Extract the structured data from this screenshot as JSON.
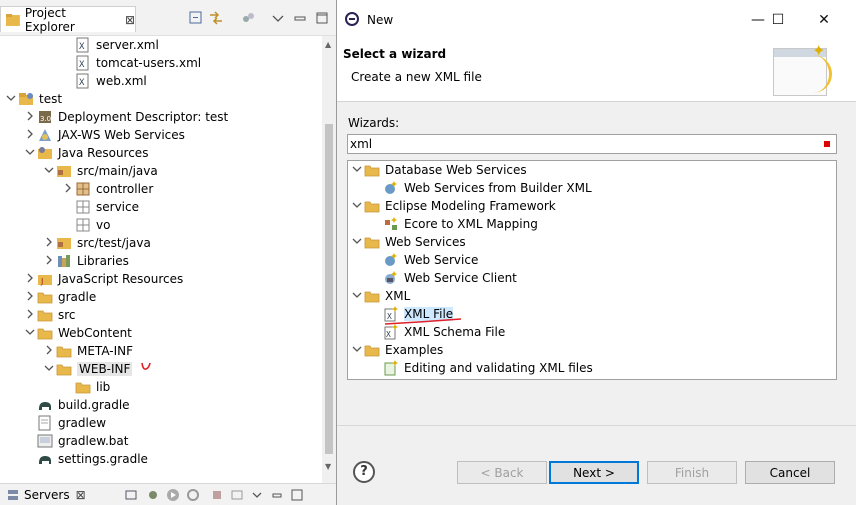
{
  "project_explorer": {
    "tab_label": "Project Explorer",
    "close_glyph": "⊠",
    "toolbar_icons": [
      "collapse-all-icon",
      "link-with-editor-icon",
      "filters-icon",
      "view-menu-icon",
      "minimize-icon",
      "maximize-icon"
    ],
    "tree": [
      {
        "label": "server.xml",
        "depth": 3,
        "icon": "xml-file-icon",
        "twisty": ""
      },
      {
        "label": "tomcat-users.xml",
        "depth": 3,
        "icon": "xml-file-icon",
        "twisty": ""
      },
      {
        "label": "web.xml",
        "depth": 3,
        "icon": "xml-file-icon",
        "twisty": ""
      },
      {
        "label": "test",
        "depth": 0,
        "icon": "project-icon",
        "twisty": "open"
      },
      {
        "label": "Deployment Descriptor: test",
        "depth": 1,
        "icon": "deployment-descriptor-icon",
        "twisty": "closed"
      },
      {
        "label": "JAX-WS Web Services",
        "depth": 1,
        "icon": "jaxws-icon",
        "twisty": "closed"
      },
      {
        "label": "Java Resources",
        "depth": 1,
        "icon": "java-resources-icon",
        "twisty": "open"
      },
      {
        "label": "src/main/java",
        "depth": 2,
        "icon": "source-folder-icon",
        "twisty": "open"
      },
      {
        "label": "controller",
        "depth": 3,
        "icon": "package-icon",
        "twisty": "closed"
      },
      {
        "label": "service",
        "depth": 3,
        "icon": "empty-package-icon",
        "twisty": ""
      },
      {
        "label": "vo",
        "depth": 3,
        "icon": "empty-package-icon",
        "twisty": ""
      },
      {
        "label": "src/test/java",
        "depth": 2,
        "icon": "source-folder-icon",
        "twisty": "closed"
      },
      {
        "label": "Libraries",
        "depth": 2,
        "icon": "libraries-icon",
        "twisty": "closed"
      },
      {
        "label": "JavaScript Resources",
        "depth": 1,
        "icon": "javascript-resources-icon",
        "twisty": "closed"
      },
      {
        "label": "gradle",
        "depth": 1,
        "icon": "folder-icon",
        "twisty": "closed"
      },
      {
        "label": "src",
        "depth": 1,
        "icon": "folder-icon",
        "twisty": "closed"
      },
      {
        "label": "WebContent",
        "depth": 1,
        "icon": "folder-icon",
        "twisty": "open"
      },
      {
        "label": "META-INF",
        "depth": 2,
        "icon": "folder-icon",
        "twisty": "closed"
      },
      {
        "label": "WEB-INF",
        "depth": 2,
        "icon": "folder-icon",
        "twisty": "open",
        "selected": true
      },
      {
        "label": "lib",
        "depth": 3,
        "icon": "folder-icon",
        "twisty": ""
      },
      {
        "label": "build.gradle",
        "depth": 1,
        "icon": "gradle-icon",
        "twisty": ""
      },
      {
        "label": "gradlew",
        "depth": 1,
        "icon": "file-icon",
        "twisty": ""
      },
      {
        "label": "gradlew.bat",
        "depth": 1,
        "icon": "bat-file-icon",
        "twisty": ""
      },
      {
        "label": "settings.gradle",
        "depth": 1,
        "icon": "gradle-icon",
        "twisty": ""
      }
    ]
  },
  "servers": {
    "tab_label": "Servers",
    "close_glyph": "⊠",
    "toolbar_icons": [
      "server-list-icon",
      "debug-server-icon",
      "start-server-icon",
      "profile-server-icon",
      "stop-server-icon",
      "publish-icon",
      "view-menu-icon",
      "minimize-icon",
      "maximize-icon"
    ]
  },
  "dialog": {
    "title": "New",
    "controls": {
      "minimize": "—",
      "maximize": "☐",
      "close": "✕"
    },
    "heading": "Select a wizard",
    "description": "Create a new XML file",
    "wizards_label": "Wizards:",
    "filter_value": "xml",
    "tree": [
      {
        "label": "Database Web Services",
        "depth": 0,
        "icon": "folder-icon",
        "twisty": "open"
      },
      {
        "label": "Web Services from Builder XML",
        "depth": 1,
        "icon": "web-service-wizard-icon",
        "twisty": ""
      },
      {
        "label": "Eclipse Modeling Framework",
        "depth": 0,
        "icon": "folder-icon",
        "twisty": "open"
      },
      {
        "label": "Ecore to XML Mapping",
        "depth": 1,
        "icon": "ecore-mapping-icon",
        "twisty": ""
      },
      {
        "label": "Web Services",
        "depth": 0,
        "icon": "folder-icon",
        "twisty": "open"
      },
      {
        "label": "Web Service",
        "depth": 1,
        "icon": "web-service-wizard-icon",
        "twisty": ""
      },
      {
        "label": "Web Service Client",
        "depth": 1,
        "icon": "web-service-client-icon",
        "twisty": ""
      },
      {
        "label": "XML",
        "depth": 0,
        "icon": "folder-icon",
        "twisty": "open"
      },
      {
        "label": "XML File",
        "depth": 1,
        "icon": "xml-file-wizard-icon",
        "twisty": "",
        "selected": true
      },
      {
        "label": "XML Schema File",
        "depth": 1,
        "icon": "xml-schema-icon",
        "twisty": ""
      },
      {
        "label": "Examples",
        "depth": 0,
        "icon": "folder-icon",
        "twisty": "open"
      },
      {
        "label": "Editing and validating XML files",
        "depth": 1,
        "icon": "example-icon",
        "twisty": ""
      }
    ],
    "buttons": {
      "back": "< Back",
      "next": "Next >",
      "finish": "Finish",
      "cancel": "Cancel"
    }
  }
}
